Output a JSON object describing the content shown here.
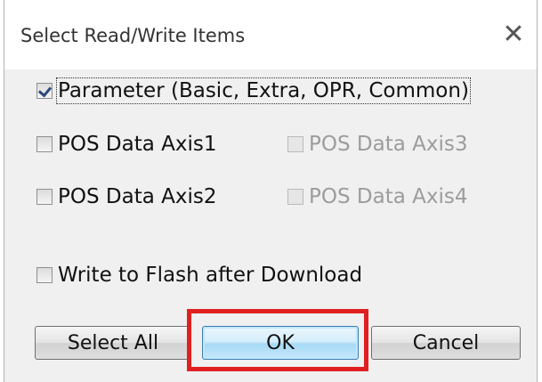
{
  "dialog": {
    "title": "Select Read/Write Items",
    "close_glyph": "✕"
  },
  "options": {
    "parameter": {
      "label": "Parameter (Basic, Extra, OPR, Common)",
      "checked": true,
      "enabled": true
    },
    "pos_axis1": {
      "label": "POS Data Axis1",
      "checked": false,
      "enabled": true
    },
    "pos_axis2": {
      "label": "POS Data Axis2",
      "checked": false,
      "enabled": true
    },
    "pos_axis3": {
      "label": "POS Data Axis3",
      "checked": false,
      "enabled": false
    },
    "pos_axis4": {
      "label": "POS Data Axis4",
      "checked": false,
      "enabled": false
    },
    "write_flash": {
      "label": "Write to Flash after Download",
      "checked": false,
      "enabled": true
    }
  },
  "buttons": {
    "select_all": "Select All",
    "ok": "OK",
    "cancel": "Cancel"
  },
  "colors": {
    "highlight": "#e02020",
    "disabled_text": "#9c9c9c"
  }
}
